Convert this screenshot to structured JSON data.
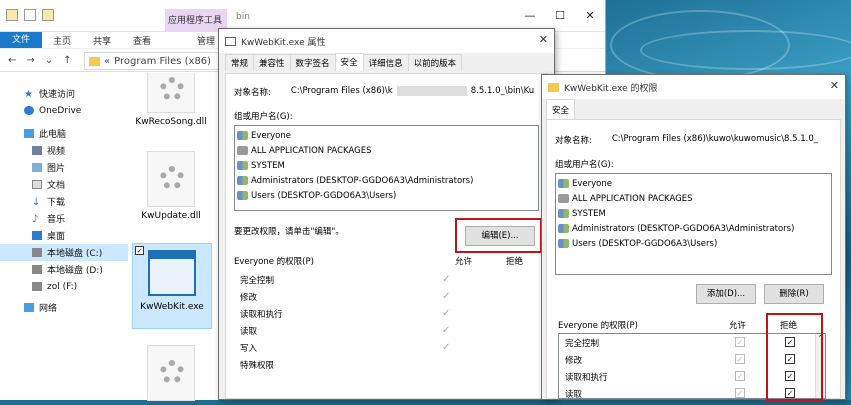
{
  "explorer": {
    "context_tab": "应用程序工具",
    "title": "bin",
    "ribbon": {
      "file": "文件",
      "home": "主页",
      "share": "共享",
      "view": "查看",
      "manage": "管理"
    },
    "address": "Program Files (x86)",
    "nav": [
      {
        "label": "快速访问"
      },
      {
        "label": "OneDrive"
      },
      {
        "label": "此电脑"
      },
      {
        "label": "视频"
      },
      {
        "label": "图片"
      },
      {
        "label": "文档"
      },
      {
        "label": "下载"
      },
      {
        "label": "音乐"
      },
      {
        "label": "桌面"
      },
      {
        "label": "本地磁盘 (C:)"
      },
      {
        "label": "本地磁盘 (D:)"
      },
      {
        "label": "zol (F:)"
      },
      {
        "label": "网络"
      }
    ],
    "files": [
      {
        "name": "KwRecoSong.dll"
      },
      {
        "name": "KwUpdate.dll"
      },
      {
        "name": "KwWebKit.exe"
      }
    ]
  },
  "props": {
    "title": "KwWebKit.exe 属性",
    "tabs": [
      "常规",
      "兼容性",
      "数字签名",
      "安全",
      "详细信息",
      "以前的版本"
    ],
    "object_label": "对象名称:",
    "object_value_a": "C:\\Program Files (x86)\\k",
    "object_value_b": "8.5.1.0_\\bin\\Ku",
    "group_label": "组或用户名(G):",
    "users": [
      "Everyone",
      "ALL APPLICATION PACKAGES",
      "SYSTEM",
      "Administrators (DESKTOP-GGDO6A3\\Administrators)",
      "Users (DESKTOP-GGDO6A3\\Users)"
    ],
    "change_text": "要更改权限，请单击\"编辑\"。",
    "edit_button": "编辑(E)...",
    "perm_title": "Everyone 的权限(P)",
    "allow": "允许",
    "deny": "拒绝",
    "perms": [
      "完全控制",
      "修改",
      "读取和执行",
      "读取",
      "写入",
      "特殊权限"
    ]
  },
  "perms_dialog": {
    "title": "KwWebKit.exe 的权限",
    "tab": "安全",
    "object_label": "对象名称:",
    "object_value": "C:\\Program Files (x86)\\kuwo\\kuwomusic\\8.5.1.0_",
    "group_label": "组或用户名(G):",
    "users": [
      "Everyone",
      "ALL APPLICATION PACKAGES",
      "SYSTEM",
      "Administrators (DESKTOP-GGDO6A3\\Administrators)",
      "Users (DESKTOP-GGDO6A3\\Users)"
    ],
    "add_button": "添加(D)...",
    "remove_button": "删除(R)",
    "perm_title": "Everyone 的权限(P)",
    "allow": "允许",
    "deny": "拒绝",
    "perms": [
      "完全控制",
      "修改",
      "读取和执行",
      "读取"
    ]
  }
}
